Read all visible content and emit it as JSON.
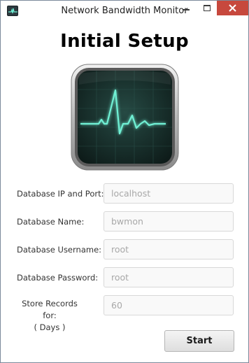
{
  "window": {
    "title": "Network Bandwidth Monitor",
    "app_icon": "activity-monitor-icon",
    "controls": [
      "minimize-icon",
      "maximize-icon",
      "close-icon"
    ]
  },
  "main": {
    "heading": "Initial Setup",
    "logo_icon": "heartbeat-monitor-icon"
  },
  "form": {
    "db_ip_port": {
      "label": "Database IP and Port:",
      "value": "localhost"
    },
    "db_name": {
      "label": "Database Name:",
      "value": "bwmon"
    },
    "db_username": {
      "label": "Database Username:",
      "value": "root"
    },
    "db_password": {
      "label": "Database Password:",
      "value": "root"
    },
    "store_records": {
      "label_line1": "Store Records for:",
      "label_line2": "( Days )",
      "value": "60"
    }
  },
  "actions": {
    "start_label": "Start"
  },
  "colors": {
    "close_button": "#c7483d",
    "pulse_line": "#6ff0d4",
    "field_text": "#a8a8a8"
  }
}
